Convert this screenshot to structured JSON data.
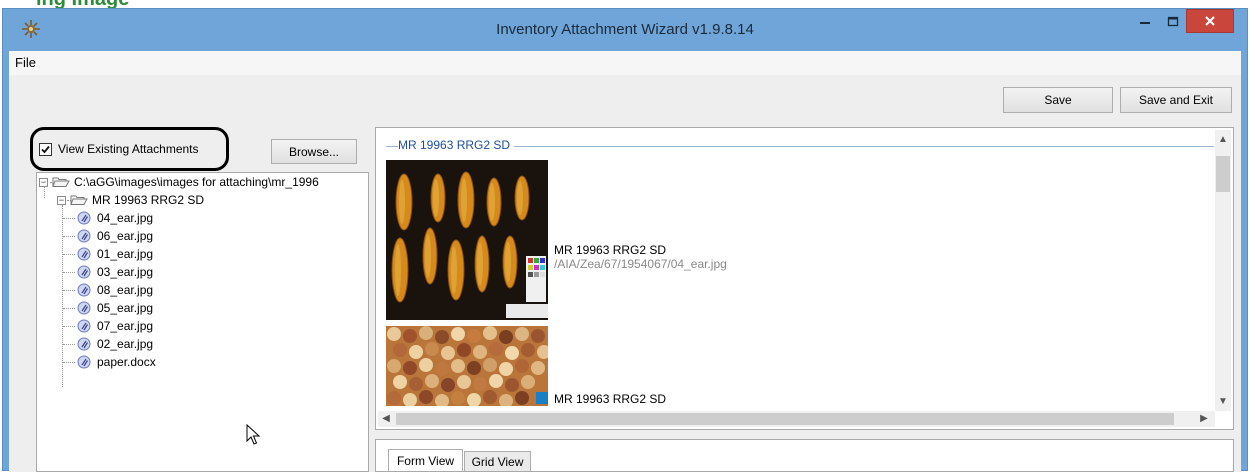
{
  "window": {
    "title": "Inventory Attachment Wizard v1.9.8.14"
  },
  "menu": {
    "file_label": "File"
  },
  "toolbar": {
    "save_label": "Save",
    "save_exit_label": "Save and Exit"
  },
  "left_panel": {
    "view_existing_label": "View Existing Attachments",
    "view_existing_checked": true,
    "browse_label": "Browse..."
  },
  "tree": {
    "root_label": "C:\\aGG\\images\\images for attaching\\mr_1996",
    "folder_label": "MR 19963 RRG2 SD",
    "files": [
      "04_ear.jpg",
      "06_ear.jpg",
      "01_ear.jpg",
      "03_ear.jpg",
      "08_ear.jpg",
      "05_ear.jpg",
      "07_ear.jpg",
      "02_ear.jpg",
      "paper.docx"
    ]
  },
  "attachments": {
    "group_title": "MR 19963 RRG2 SD",
    "items": [
      {
        "title": "MR 19963 RRG2 SD",
        "path": "/AIA/Zea/67/1954067/04_ear.jpg"
      },
      {
        "title": "MR 19963 RRG2 SD",
        "path": ""
      }
    ]
  },
  "bottom_tabs": {
    "form_view": "Form View",
    "grid_view": "Grid View"
  },
  "colors": {
    "title_bar": "#6fa5d8",
    "close_button": "#c9463d",
    "group_title": "#1f4fa0"
  }
}
